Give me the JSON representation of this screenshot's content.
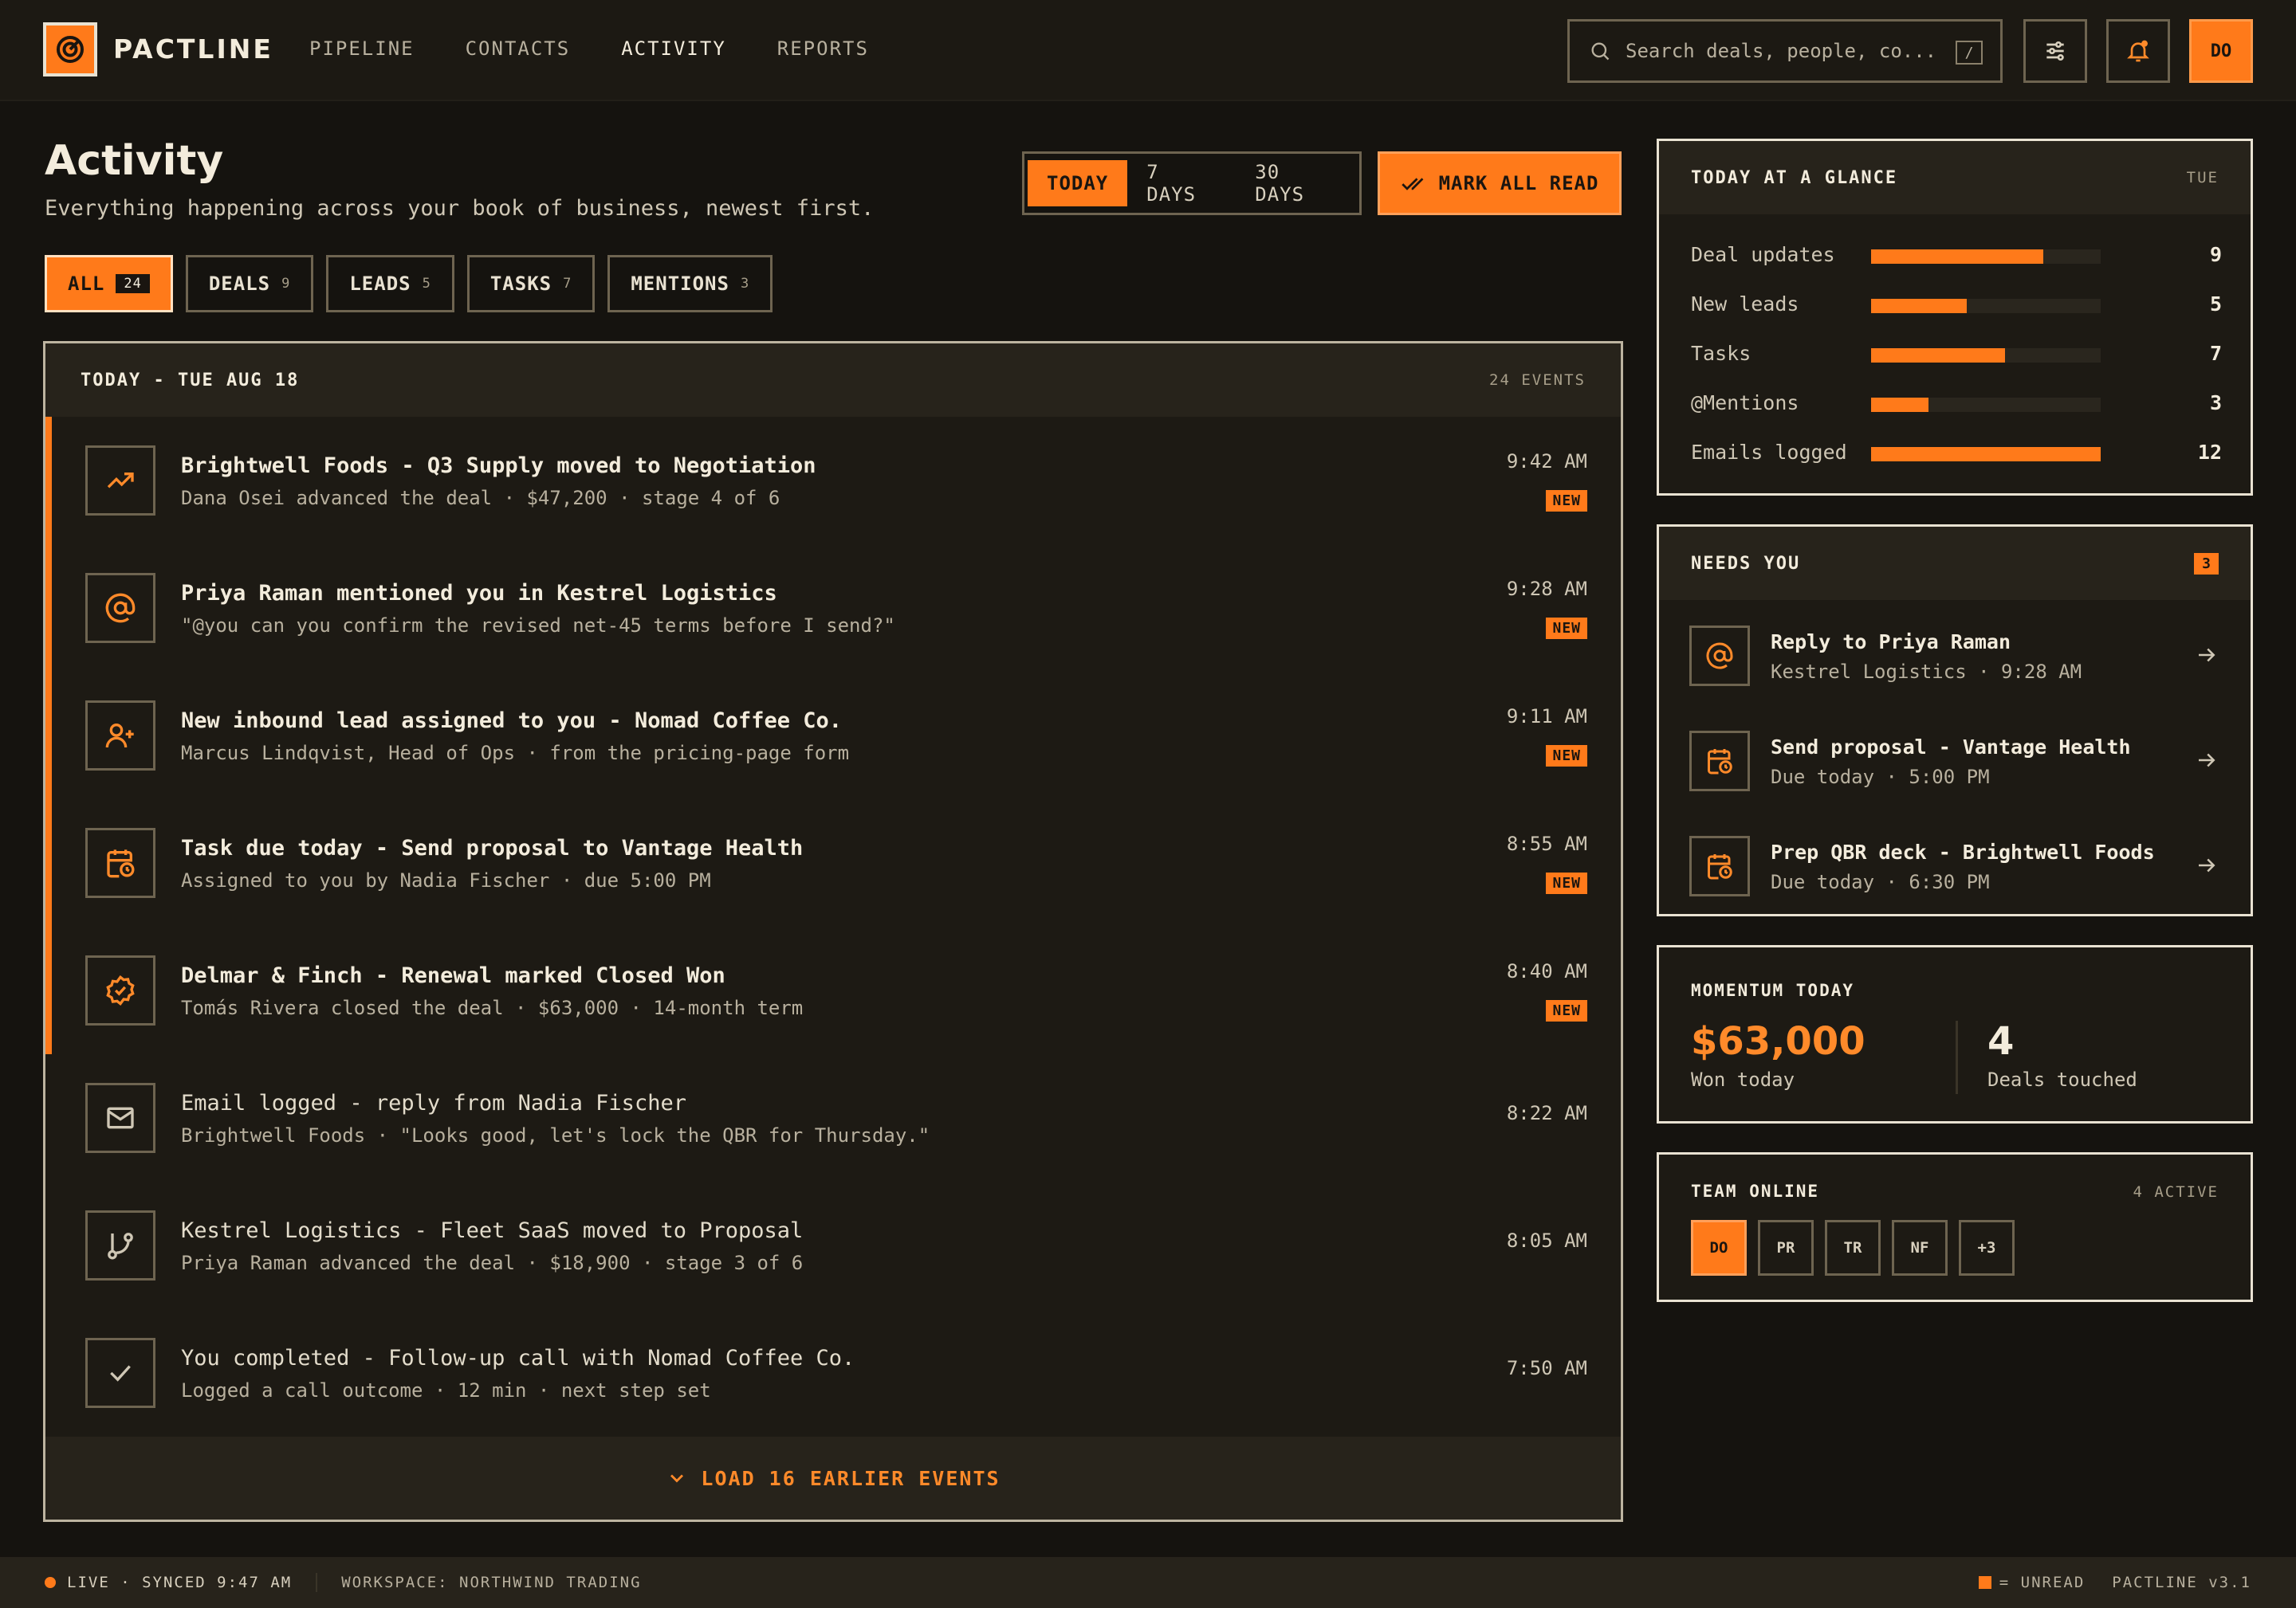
{
  "app": {
    "brand": "PACTLINE"
  },
  "nav": [
    "PIPELINE",
    "CONTACTS",
    "ACTIVITY",
    "REPORTS"
  ],
  "search": {
    "placeholder": "Search deals, people, co...",
    "shortcut": "/"
  },
  "user": {
    "initials": "DO"
  },
  "header": {
    "title": "Activity",
    "subtitle": "Everything happening across your book of business, newest first.",
    "ranges": [
      "TODAY",
      "7 DAYS",
      "30 DAYS"
    ],
    "mark_all_read": "MARK ALL READ"
  },
  "filters": [
    {
      "label": "ALL",
      "count": "24"
    },
    {
      "label": "DEALS",
      "count": "9"
    },
    {
      "label": "LEADS",
      "count": "5"
    },
    {
      "label": "TASKS",
      "count": "7"
    },
    {
      "label": "MENTIONS",
      "count": "3"
    }
  ],
  "feed": {
    "date_label": "TODAY - TUE AUG 18",
    "event_count": "24 EVENTS",
    "new_label": "NEW",
    "events": [
      {
        "icon": "trending-up-icon",
        "title": "Brightwell Foods - Q3 Supply moved to Negotiation",
        "sub": "Dana Osei advanced the deal · $47,200 · stage 4 of 6",
        "time": "9:42 AM",
        "unread": true
      },
      {
        "icon": "at-sign-icon",
        "title": "Priya Raman mentioned you in Kestrel Logistics",
        "sub": "\"@you can you confirm the revised net-45 terms before I send?\"",
        "time": "9:28 AM",
        "unread": true
      },
      {
        "icon": "user-plus-icon",
        "title": "New inbound lead assigned to you - Nomad Coffee Co.",
        "sub": "Marcus Lindqvist, Head of Ops · from the pricing-page form",
        "time": "9:11 AM",
        "unread": true
      },
      {
        "icon": "calendar-clock-icon",
        "title": "Task due today - Send proposal to Vantage Health",
        "sub": "Assigned to you by Nadia Fischer · due 5:00 PM",
        "time": "8:55 AM",
        "unread": true
      },
      {
        "icon": "badge-check-icon",
        "title": "Delmar & Finch - Renewal marked Closed Won",
        "sub": "Tomás Rivera closed the deal · $63,000 · 14-month term",
        "time": "8:40 AM",
        "unread": true
      },
      {
        "icon": "mail-icon",
        "title": "Email logged - reply from Nadia Fischer",
        "sub": "Brightwell Foods · \"Looks good, let's lock the QBR for Thursday.\"",
        "time": "8:22 AM",
        "unread": false
      },
      {
        "icon": "git-branch-icon",
        "title": "Kestrel Logistics - Fleet SaaS moved to Proposal",
        "sub": "Priya Raman advanced the deal · $18,900 · stage 3 of 6",
        "time": "8:05 AM",
        "unread": false
      },
      {
        "icon": "check-icon",
        "title": "You completed - Follow-up call with Nomad Coffee Co.",
        "sub": "Logged a call outcome · 12 min · next step set",
        "time": "7:50 AM",
        "unread": false
      }
    ],
    "load_more": "LOAD 16 EARLIER EVENTS"
  },
  "glance": {
    "title": "TODAY AT A GLANCE",
    "day": "TUE",
    "max": 12,
    "rows": [
      {
        "label": "Deal updates",
        "value": 9
      },
      {
        "label": "New leads",
        "value": 5
      },
      {
        "label": "Tasks",
        "value": 7
      },
      {
        "label": "@Mentions",
        "value": 3
      },
      {
        "label": "Emails logged",
        "value": 12
      }
    ]
  },
  "needs": {
    "title": "NEEDS YOU",
    "count": "3",
    "items": [
      {
        "icon": "at-sign-icon",
        "title": "Reply to Priya Raman",
        "sub": "Kestrel Logistics · 9:28 AM"
      },
      {
        "icon": "calendar-clock-icon",
        "title": "Send proposal - Vantage Health",
        "sub": "Due today · 5:00 PM"
      },
      {
        "icon": "calendar-clock-icon",
        "title": "Prep QBR deck - Brightwell Foods",
        "sub": "Due today · 6:30 PM"
      }
    ]
  },
  "momentum": {
    "title": "MOMENTUM TODAY",
    "won_value": "$63,000",
    "won_label": "Won today",
    "deals_value": "4",
    "deals_label": "Deals touched"
  },
  "team": {
    "title": "TEAM ONLINE",
    "active": "4 ACTIVE",
    "members": [
      "DO",
      "PR",
      "TR",
      "NF",
      "+3"
    ]
  },
  "footer": {
    "status": "LIVE · SYNCED 9:47 AM",
    "workspace": "WORKSPACE: NORTHWIND TRADING",
    "legend": "= UNREAD",
    "version": "PACTLINE v3.1"
  },
  "colors": {
    "accent": "#ff7a1a",
    "background": "#15130f"
  }
}
